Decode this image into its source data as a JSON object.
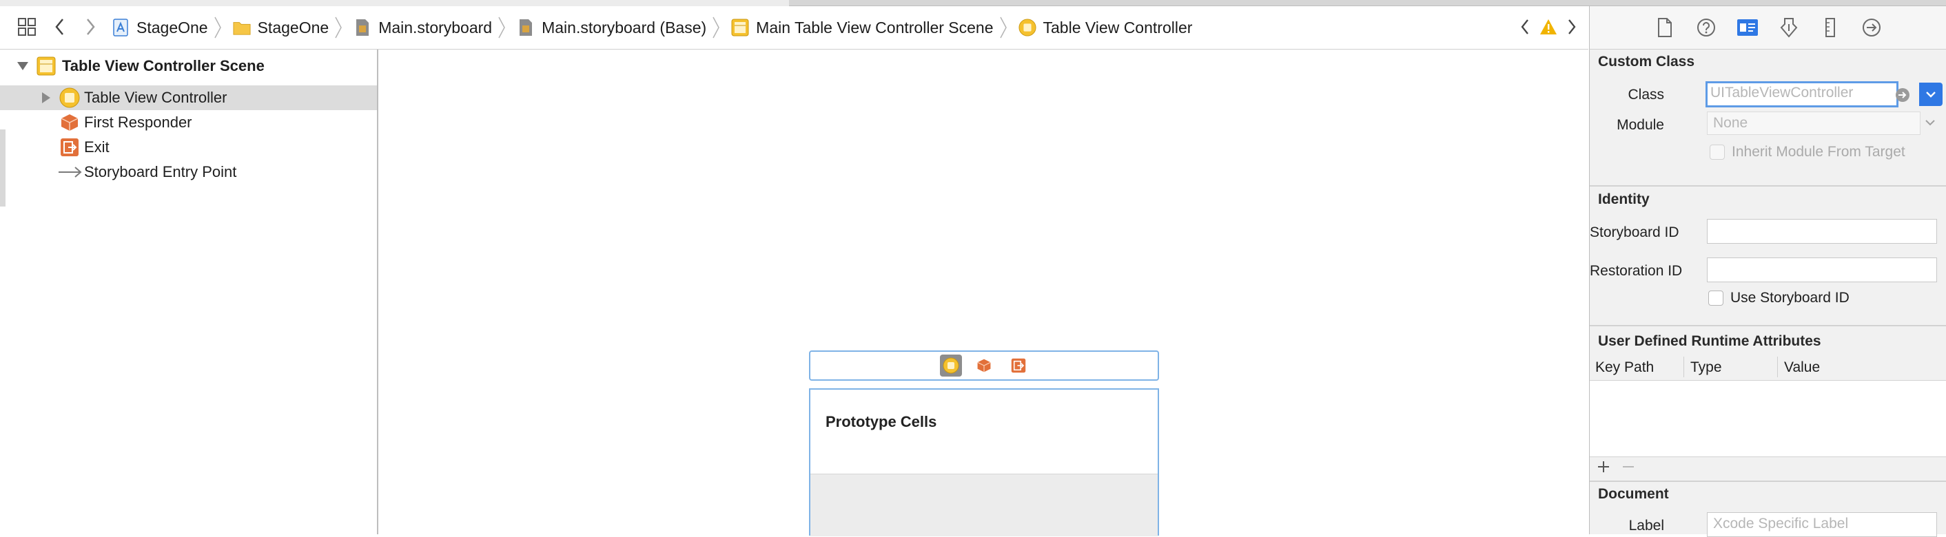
{
  "jumpbar": {
    "breadcrumbs": [
      {
        "label": "StageOne",
        "icon": "project-icon"
      },
      {
        "label": "StageOne",
        "icon": "folder-icon"
      },
      {
        "label": "Main.storyboard",
        "icon": "storyboard-icon"
      },
      {
        "label": "Main.storyboard (Base)",
        "icon": "storyboard-icon"
      },
      {
        "label": "Main Table View Controller Scene",
        "icon": "scene-icon"
      },
      {
        "label": "Table View Controller",
        "icon": "view-controller-icon"
      }
    ]
  },
  "outline": {
    "items": [
      {
        "label": "Table View Controller Scene",
        "icon": "scene-icon"
      },
      {
        "label": "Table View Controller",
        "icon": "view-controller-icon"
      },
      {
        "label": "First Responder",
        "icon": "first-responder-icon"
      },
      {
        "label": "Exit",
        "icon": "exit-icon"
      },
      {
        "label": "Storyboard Entry Point",
        "icon": "entry-arrow-icon"
      }
    ]
  },
  "canvas": {
    "prototype_cells_label": "Prototype Cells"
  },
  "inspector": {
    "custom_class": {
      "title": "Custom Class",
      "class_label": "Class",
      "class_placeholder": "UITableViewController",
      "module_label": "Module",
      "module_placeholder": "None",
      "inherit_label": "Inherit Module From Target"
    },
    "identity": {
      "title": "Identity",
      "storyboard_id_label": "Storyboard ID",
      "restoration_id_label": "Restoration ID",
      "use_storyboard_id_label": "Use Storyboard ID"
    },
    "runtime_attributes": {
      "title": "User Defined Runtime Attributes",
      "columns": [
        "Key Path",
        "Type",
        "Value"
      ]
    },
    "document": {
      "title": "Document",
      "label_label": "Label",
      "label_placeholder": "Xcode Specific Label"
    }
  },
  "colors": {
    "accent": "#2f78e4",
    "selection": "#dcdcdc",
    "scene_yellow": "#f5c12e",
    "object_orange": "#e2703a",
    "warning": "#f1b400"
  }
}
